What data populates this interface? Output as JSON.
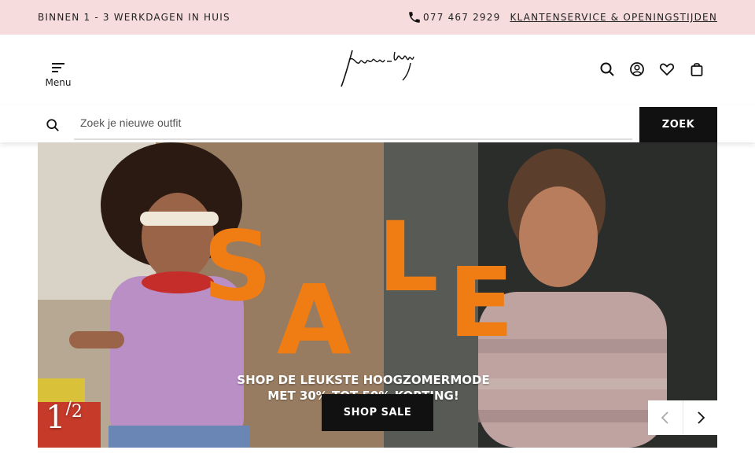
{
  "topbar": {
    "delivery": "BINNEN 1 - 3 WERKDAGEN IN HUIS",
    "phone": "077 467 2929",
    "service_link": "KLANTENSERVICE & OPENINGSTIJDEN"
  },
  "header": {
    "menu_label": "Menu",
    "icons": [
      "search-icon",
      "account-icon",
      "heart-icon",
      "bag-icon"
    ]
  },
  "search": {
    "placeholder": "Zoek je nieuwe outfit",
    "button": "ZOEK"
  },
  "hero": {
    "sale_letters": [
      "S",
      "A",
      "L",
      "E"
    ],
    "promo_line1": "SHOP DE LEUKSTE HOOGZOMERMODE",
    "promo_line2": "MET 30% TOT 50% KORTING!",
    "cta": "SHOP SALE",
    "slide_current": "1",
    "slide_separator": "/",
    "slide_total": "2",
    "sale_color": "#f07c14"
  },
  "colors": {
    "topbar_bg": "#f6dcdc",
    "button_bg": "#111111"
  }
}
